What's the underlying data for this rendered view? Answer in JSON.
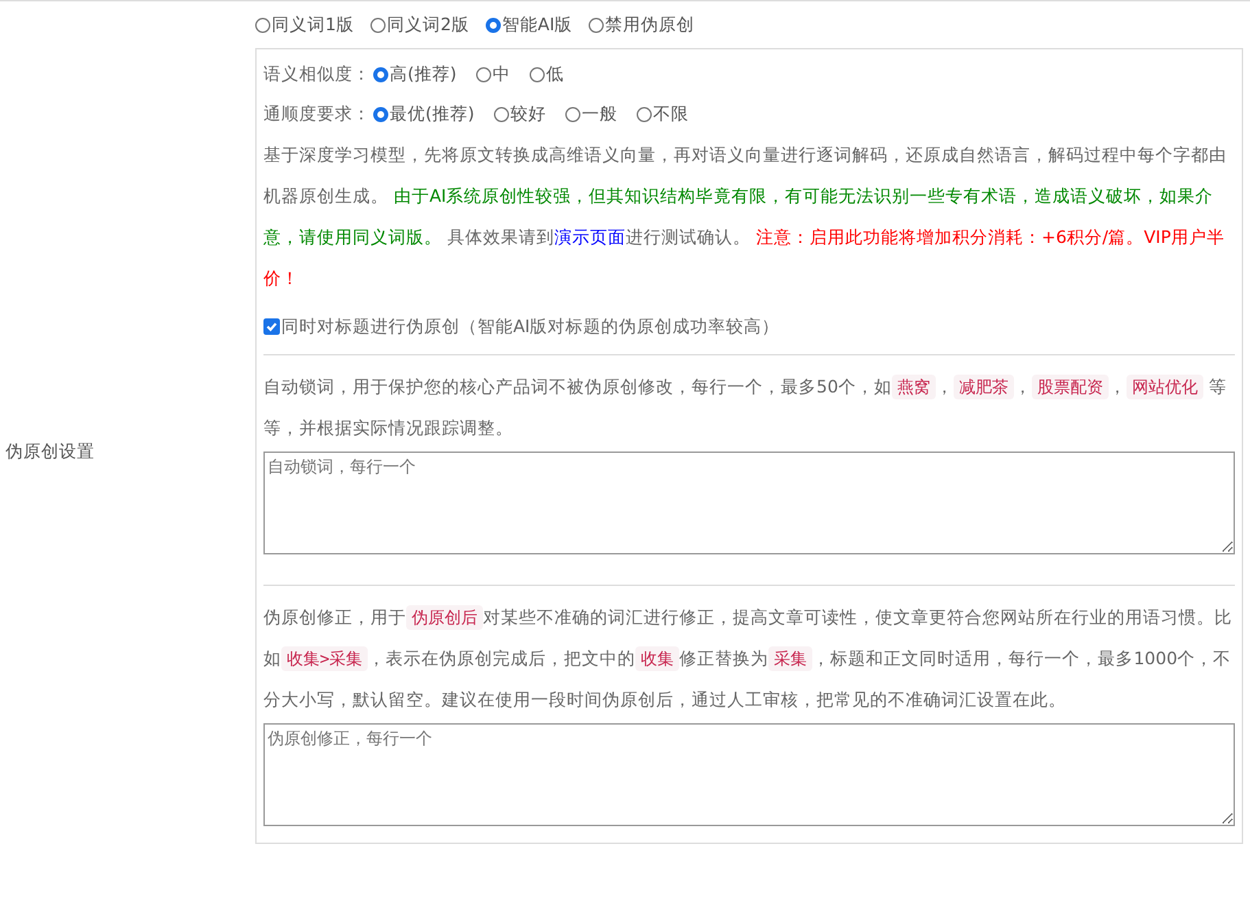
{
  "section_label": "伪原创设置",
  "modes": [
    {
      "label": "同义词1版",
      "selected": false
    },
    {
      "label": "同义词2版",
      "selected": false
    },
    {
      "label": "智能AI版",
      "selected": true
    },
    {
      "label": "禁用伪原创",
      "selected": false
    }
  ],
  "option_groups": [
    {
      "label": "语义相似度：",
      "options": [
        {
          "label": "高(推荐)",
          "selected": true
        },
        {
          "label": "中",
          "selected": false
        },
        {
          "label": "低",
          "selected": false
        }
      ]
    },
    {
      "label": "通顺度要求：",
      "options": [
        {
          "label": "最优(推荐)",
          "selected": true
        },
        {
          "label": "较好",
          "selected": false
        },
        {
          "label": "一般",
          "selected": false
        },
        {
          "label": "不限",
          "selected": false
        }
      ]
    }
  ],
  "ai_description": [
    {
      "kind": "plain",
      "text": "基于深度学习模型，先将原文转换成高维语义向量，再对语义向量进行逐词解码，还原成自然语言，解码过程中每个字都由机器原创生成。 "
    },
    {
      "kind": "green",
      "text": "由于AI系统原创性较强，但其知识结构毕竟有限，有可能无法识别一些专有术语，造成语义破坏，如果介意，请使用同义词版。"
    },
    {
      "kind": "plain",
      "text": " 具体效果请到"
    },
    {
      "kind": "link",
      "text": "演示页面"
    },
    {
      "kind": "plain",
      "text": "进行测试确认。 "
    },
    {
      "kind": "red",
      "text": "注意：启用此功能将增加积分消耗：+6积分/篇。VIP用户半价！"
    }
  ],
  "title_option": {
    "label": "同时对标题进行伪原创（智能AI版对标题的伪原创成功率较高）",
    "checked": true
  },
  "lock_words": {
    "description": [
      {
        "kind": "plain",
        "text": "自动锁词，用于保护您的核心产品词不被伪原创修改，每行一个，最多50个，如"
      },
      {
        "kind": "code",
        "text": "燕窝"
      },
      {
        "kind": "plain",
        "text": "，"
      },
      {
        "kind": "code",
        "text": "减肥茶"
      },
      {
        "kind": "plain",
        "text": "，"
      },
      {
        "kind": "code",
        "text": "股票配资"
      },
      {
        "kind": "plain",
        "text": "，"
      },
      {
        "kind": "code",
        "text": "网站优化"
      },
      {
        "kind": "plain",
        "text": " 等等，并根据实际情况跟踪调整。"
      }
    ],
    "placeholder": "自动锁词，每行一个"
  },
  "corrections": {
    "description": [
      {
        "kind": "plain",
        "text": "伪原创修正，用于"
      },
      {
        "kind": "code",
        "text": "伪原创后"
      },
      {
        "kind": "plain",
        "text": "对某些不准确的词汇进行修正，提高文章可读性，使文章更符合您网站所在行业的用语习惯。比如"
      },
      {
        "kind": "code",
        "text": "收集>采集"
      },
      {
        "kind": "plain",
        "text": "，表示在伪原创完成后，把文中的"
      },
      {
        "kind": "code",
        "text": "收集"
      },
      {
        "kind": "plain",
        "text": "修正替换为"
      },
      {
        "kind": "code",
        "text": "采集"
      },
      {
        "kind": "plain",
        "text": "，标题和正文同时适用，每行一个，最多1000个，不分大小写，默认留空。建议在使用一段时间伪原创后，通过人工审核，把常见的不准确词汇设置在此。"
      }
    ],
    "placeholder": "伪原创修正，每行一个"
  }
}
